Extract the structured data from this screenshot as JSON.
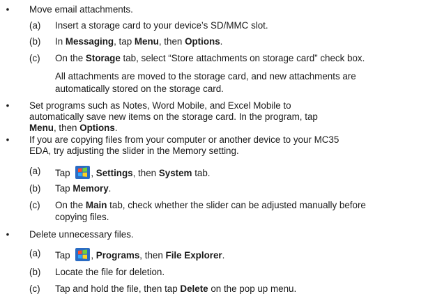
{
  "items": {
    "b1": "Move email attachments.",
    "b1a": "Insert a storage card to your device’s SD/MMC slot.",
    "b1b_1": "In ",
    "b1b_2": "Messaging",
    "b1b_3": ", tap ",
    "b1b_4": "Menu",
    "b1b_5": ", then ",
    "b1b_6": "Options",
    "b1b_7": ".",
    "b1c_1": "On the ",
    "b1c_2": "Storage",
    "b1c_3": " tab, select “Store attachments on storage card” check box.",
    "b1note_l1": "All attachments are moved to the storage card, and new attachments are",
    "b1note_l2": "automatically stored on the storage card.",
    "b2_l1": "Set programs such as Notes, Word Mobile, and Excel Mobile to",
    "b2_l2": "automatically save new items on the storage card. In the program, tap",
    "b2_l3_1": "Menu",
    "b2_l3_2": ", then ",
    "b2_l3_3": "Options",
    "b2_l3_4": ".",
    "b3_l1": "If you are copying files from your computer or another device to your MC35",
    "b3_l2": "EDA, try adjusting the slider in the Memory setting.",
    "b3a_1": "Tap ",
    "b3a_2": ", ",
    "b3a_3": "Settings",
    "b3a_4": ", then ",
    "b3a_5": "System",
    "b3a_6": " tab.",
    "b3b_1": "Tap ",
    "b3b_2": "Memory",
    "b3b_3": ".",
    "b3c_1": "On the ",
    "b3c_2": "Main",
    "b3c_3": " tab, check whether the slider can be adjusted manually before",
    "b3c_l2": "copying files.",
    "b4": "Delete unnecessary files.",
    "b4a_1": "Tap ",
    "b4a_2": ", ",
    "b4a_3": "Programs",
    "b4a_4": ", then ",
    "b4a_5": "File Explorer",
    "b4a_6": ".",
    "b4b": "Locate the file for deletion.",
    "b4c_1": "Tap and hold the file, then tap ",
    "b4c_2": "Delete",
    "b4c_3": " on the pop up menu."
  },
  "labels": {
    "a": "(a)",
    "b": "(b)",
    "c": "(c)",
    "bullet": "•"
  },
  "icons": {
    "start": "windows-start-icon"
  }
}
